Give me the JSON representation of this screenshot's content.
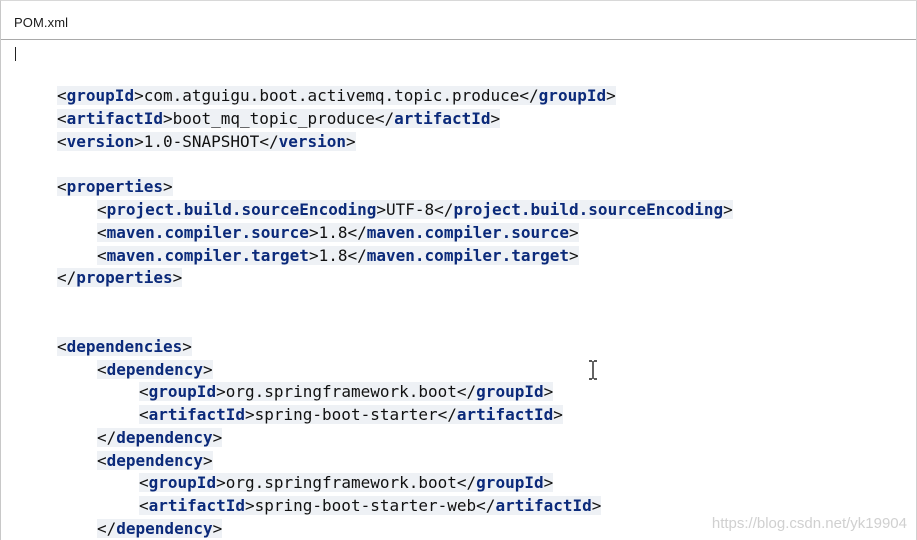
{
  "window": {
    "title": "POM.xml"
  },
  "editor": {
    "lines": [
      {
        "open": "<",
        "tag": "groupId",
        "close": ">",
        "text": "com.atguigu.boot.activemq.topic.produce",
        "open2": "</",
        "tag2": "groupId",
        "close2": ">"
      },
      {
        "open": "<",
        "tag": "artifactId",
        "close": ">",
        "text": "boot_mq_topic_produce",
        "open2": "</",
        "tag2": "artifactId",
        "close2": ">"
      },
      {
        "open": "<",
        "tag": "version",
        "close": ">",
        "text": "1.0-SNAPSHOT",
        "open2": "</",
        "tag2": "version",
        "close2": ">"
      },
      {
        "open": "<",
        "tag": "properties",
        "close": ">"
      },
      {
        "open": "<",
        "tag": "project.build.sourceEncoding",
        "close": ">",
        "text": "UTF-8",
        "open2": "</",
        "tag2": "project.build.sourceEncoding",
        "close2": ">"
      },
      {
        "open": "<",
        "tag": "maven.compiler.source",
        "close": ">",
        "text": "1.8",
        "open2": "</",
        "tag2": "maven.compiler.source",
        "close2": ">"
      },
      {
        "open": "<",
        "tag": "maven.compiler.target",
        "close": ">",
        "text": "1.8",
        "open2": "</",
        "tag2": "maven.compiler.target",
        "close2": ">"
      },
      {
        "open": "</",
        "tag": "properties",
        "close": ">"
      },
      {
        "open": "<",
        "tag": "dependencies",
        "close": ">"
      },
      {
        "open": "<",
        "tag": "dependency",
        "close": ">"
      },
      {
        "open": "<",
        "tag": "groupId",
        "close": ">",
        "text": "org.springframework.boot",
        "open2": "</",
        "tag2": "groupId",
        "close2": ">"
      },
      {
        "open": "<",
        "tag": "artifactId",
        "close": ">",
        "text": "spring-boot-starter",
        "open2": "</",
        "tag2": "artifactId",
        "close2": ">"
      },
      {
        "open": "</",
        "tag": "dependency",
        "close": ">"
      },
      {
        "open": "<",
        "tag": "dependency",
        "close": ">"
      },
      {
        "open": "<",
        "tag": "groupId",
        "close": ">",
        "text": "org.springframework.boot",
        "open2": "</",
        "tag2": "groupId",
        "close2": ">"
      },
      {
        "open": "<",
        "tag": "artifactId",
        "close": ">",
        "text": "spring-boot-starter-web",
        "open2": "</",
        "tag2": "artifactId",
        "close2": ">"
      },
      {
        "open": "</",
        "tag": "dependency",
        "close": ">"
      }
    ]
  },
  "watermark": {
    "text": "https://blog.csdn.net/yk19904"
  },
  "colors": {
    "tag": "#0b2a7a",
    "text": "#111111",
    "highlight": "#eef1f5"
  },
  "icons": {
    "mouse_cursor": "text-ibeam-cursor-icon"
  }
}
